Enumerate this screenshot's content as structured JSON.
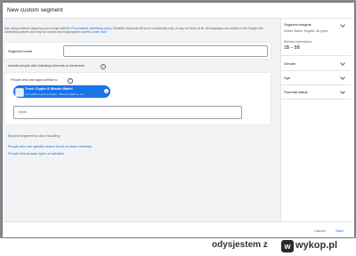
{
  "dialog": {
    "title": "New custom segment"
  },
  "notice": {
    "text_a": "Ads using audience targeting must comply with the ",
    "policy_link": "Personalized advertising policy",
    "text_b": ". Sensitive keywords will serve contextually only, or may not serve at all. All campaigns are subject to the Google Ads advertising policies and may not contain any inappropriate content. ",
    "learn_more": "Learn more"
  },
  "segment": {
    "name_label": "Segment name",
    "name_value": ""
  },
  "include": {
    "label": "Include people with following interests or behaviors",
    "help_icon": "help-icon"
  },
  "apps": {
    "label": "People who use apps similar to",
    "chip_title": "Trust: Crypto & Bitcoin Wallet",
    "chip_subtitle": "com.wallet.crypto.trustapp · Sleeps Platform, Inc.",
    "chip_close": "×",
    "search_value": "crypto"
  },
  "expand": {
    "label": "Expand segment by also including:",
    "link_terms": "People who use specific search terms or share interests",
    "link_websites": "People who browse types of websites"
  },
  "sidebar": {
    "insights_title": "Segment insights",
    "insights_sub": "United States, English, All types",
    "reach_label": "Weekly impressions",
    "reach_value": "1B – 5B",
    "gender": "Gender",
    "age": "Age",
    "parental": "Parental status"
  },
  "footer": {
    "cancel": "Cancel",
    "save": "Save"
  },
  "watermark": {
    "user": "odysjestem  z",
    "site": "wykop.pl",
    "icon_glyph": "w"
  },
  "colors": {
    "accent": "#1a73e8",
    "panel_bg": "#f1f3f4",
    "backdrop": "#8a8d92"
  }
}
